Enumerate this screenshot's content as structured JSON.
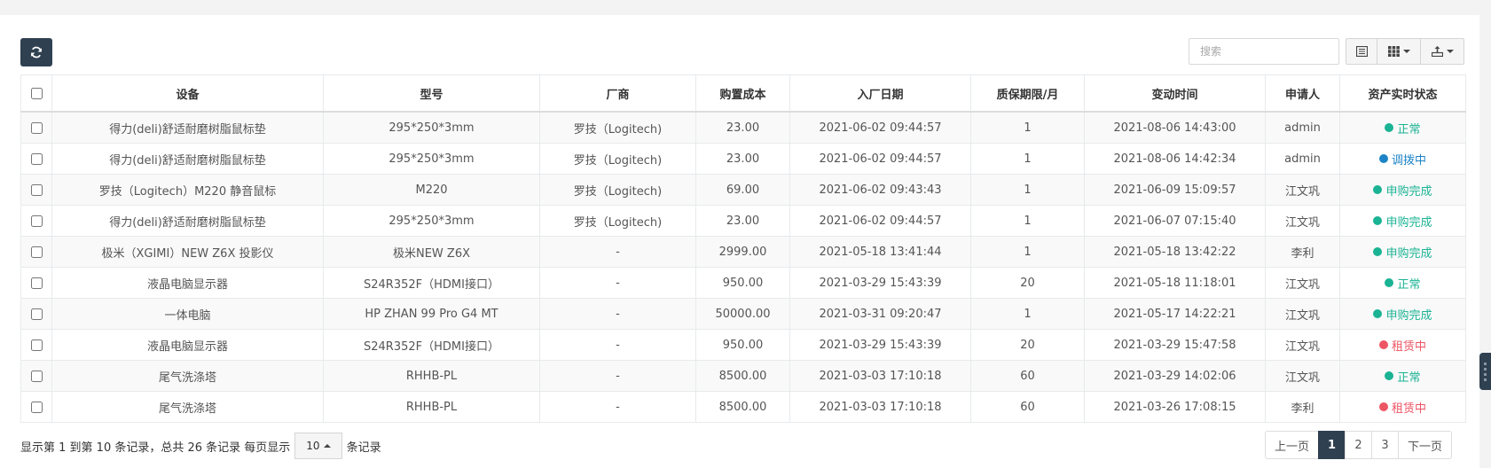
{
  "toolbar": {
    "search_placeholder": "搜索"
  },
  "table": {
    "headers": [
      "设备",
      "型号",
      "厂商",
      "购置成本",
      "入厂日期",
      "质保期限/月",
      "变动时间",
      "申请人",
      "资产实时状态"
    ],
    "rows": [
      {
        "device": "得力(deli)舒适耐磨树脂鼠标垫",
        "model": "295*250*3mm",
        "vendor": "罗技（Logitech)",
        "cost": "23.00",
        "entry_date": "2021-06-02 09:44:57",
        "warranty": "1",
        "change_time": "2021-08-06 14:43:00",
        "applicant": "admin",
        "status": "正常"
      },
      {
        "device": "得力(deli)舒适耐磨树脂鼠标垫",
        "model": "295*250*3mm",
        "vendor": "罗技（Logitech)",
        "cost": "23.00",
        "entry_date": "2021-06-02 09:44:57",
        "warranty": "1",
        "change_time": "2021-08-06 14:42:34",
        "applicant": "admin",
        "status": "调拨中"
      },
      {
        "device": "罗技（Logitech）M220 静音鼠标",
        "model": "M220",
        "vendor": "罗技（Logitech)",
        "cost": "69.00",
        "entry_date": "2021-06-02 09:43:43",
        "warranty": "1",
        "change_time": "2021-06-09 15:09:57",
        "applicant": "江文巩",
        "status": "申购完成"
      },
      {
        "device": "得力(deli)舒适耐磨树脂鼠标垫",
        "model": "295*250*3mm",
        "vendor": "罗技（Logitech)",
        "cost": "23.00",
        "entry_date": "2021-06-02 09:44:57",
        "warranty": "1",
        "change_time": "2021-06-07 07:15:40",
        "applicant": "江文巩",
        "status": "申购完成"
      },
      {
        "device": "极米（XGIMI）NEW Z6X 投影仪",
        "model": "极米NEW Z6X",
        "vendor": "-",
        "cost": "2999.00",
        "entry_date": "2021-05-18 13:41:44",
        "warranty": "1",
        "change_time": "2021-05-18 13:42:22",
        "applicant": "李利",
        "status": "申购完成"
      },
      {
        "device": "液晶电脑显示器",
        "model": "S24R352F（HDMI接口）",
        "vendor": "-",
        "cost": "950.00",
        "entry_date": "2021-03-29 15:43:39",
        "warranty": "20",
        "change_time": "2021-05-18 11:18:01",
        "applicant": "江文巩",
        "status": "正常"
      },
      {
        "device": "一体电脑",
        "model": "HP ZHAN 99 Pro G4 MT",
        "vendor": "-",
        "cost": "50000.00",
        "entry_date": "2021-03-31 09:20:47",
        "warranty": "1",
        "change_time": "2021-05-17 14:22:21",
        "applicant": "江文巩",
        "status": "申购完成"
      },
      {
        "device": "液晶电脑显示器",
        "model": "S24R352F（HDMI接口）",
        "vendor": "-",
        "cost": "950.00",
        "entry_date": "2021-03-29 15:43:39",
        "warranty": "20",
        "change_time": "2021-03-29 15:47:58",
        "applicant": "江文巩",
        "status": "租赁中"
      },
      {
        "device": "尾气洗涤塔",
        "model": "RHHB-PL",
        "vendor": "-",
        "cost": "8500.00",
        "entry_date": "2021-03-03 17:10:18",
        "warranty": "60",
        "change_time": "2021-03-29 14:02:06",
        "applicant": "江文巩",
        "status": "正常"
      },
      {
        "device": "尾气洗涤塔",
        "model": "RHHB-PL",
        "vendor": "-",
        "cost": "8500.00",
        "entry_date": "2021-03-03 17:10:18",
        "warranty": "60",
        "change_time": "2021-03-26 17:08:15",
        "applicant": "李利",
        "status": "租赁中"
      }
    ]
  },
  "status_colors": {
    "正常": "#1ab394",
    "调拨中": "#1c84c6",
    "申购完成": "#1ab394",
    "租赁中": "#ed5565"
  },
  "footer": {
    "info_prefix": "显示第 1 到第 10 条记录，总共 26 条记录 每页显示",
    "page_size": "10",
    "info_suffix": "条记录"
  },
  "pagination": {
    "prev": "上一页",
    "pages": [
      "1",
      "2",
      "3"
    ],
    "active": "1",
    "next": "下一页"
  },
  "icons": {
    "refresh": "refresh-icon",
    "list_view": "list-icon",
    "columns": "columns-icon",
    "export": "export-icon"
  }
}
